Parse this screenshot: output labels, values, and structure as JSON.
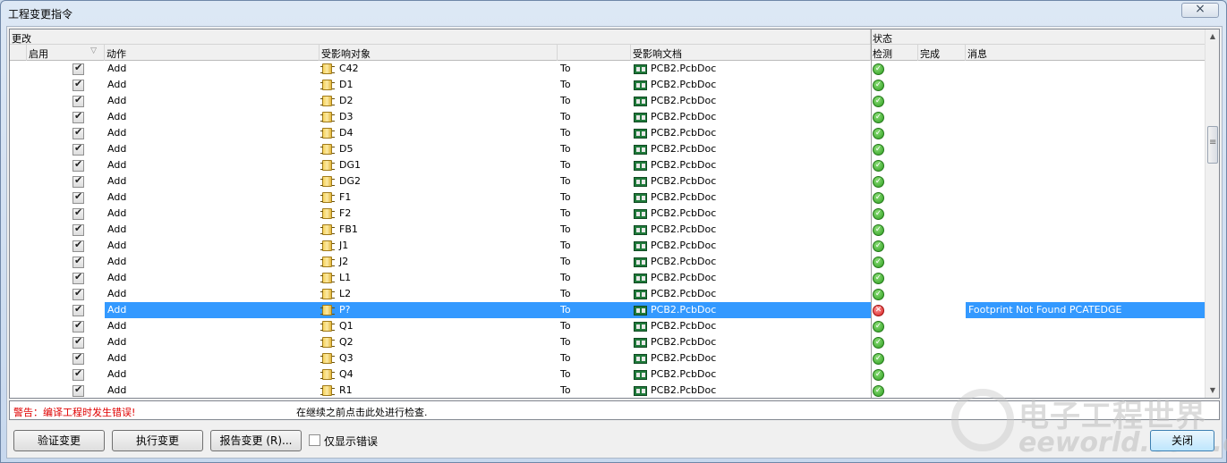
{
  "window": {
    "title": "工程变更指令",
    "close_glyph": "×"
  },
  "groups": {
    "changes": "更改",
    "status": "状态"
  },
  "columns": {
    "enable": "启用",
    "action": "动作",
    "affected_object": "受影响对象",
    "to": "",
    "affected_document": "受影响文档",
    "check": "检测",
    "done": "完成",
    "message": "消息"
  },
  "rows": [
    {
      "action": "Add",
      "object": "C42",
      "to": "To",
      "document": "PCB2.PcbDoc",
      "check": "ok",
      "message": ""
    },
    {
      "action": "Add",
      "object": "D1",
      "to": "To",
      "document": "PCB2.PcbDoc",
      "check": "ok",
      "message": ""
    },
    {
      "action": "Add",
      "object": "D2",
      "to": "To",
      "document": "PCB2.PcbDoc",
      "check": "ok",
      "message": ""
    },
    {
      "action": "Add",
      "object": "D3",
      "to": "To",
      "document": "PCB2.PcbDoc",
      "check": "ok",
      "message": ""
    },
    {
      "action": "Add",
      "object": "D4",
      "to": "To",
      "document": "PCB2.PcbDoc",
      "check": "ok",
      "message": ""
    },
    {
      "action": "Add",
      "object": "D5",
      "to": "To",
      "document": "PCB2.PcbDoc",
      "check": "ok",
      "message": ""
    },
    {
      "action": "Add",
      "object": "DG1",
      "to": "To",
      "document": "PCB2.PcbDoc",
      "check": "ok",
      "message": ""
    },
    {
      "action": "Add",
      "object": "DG2",
      "to": "To",
      "document": "PCB2.PcbDoc",
      "check": "ok",
      "message": ""
    },
    {
      "action": "Add",
      "object": "F1",
      "to": "To",
      "document": "PCB2.PcbDoc",
      "check": "ok",
      "message": ""
    },
    {
      "action": "Add",
      "object": "F2",
      "to": "To",
      "document": "PCB2.PcbDoc",
      "check": "ok",
      "message": ""
    },
    {
      "action": "Add",
      "object": "FB1",
      "to": "To",
      "document": "PCB2.PcbDoc",
      "check": "ok",
      "message": ""
    },
    {
      "action": "Add",
      "object": "J1",
      "to": "To",
      "document": "PCB2.PcbDoc",
      "check": "ok",
      "message": ""
    },
    {
      "action": "Add",
      "object": "J2",
      "to": "To",
      "document": "PCB2.PcbDoc",
      "check": "ok",
      "message": ""
    },
    {
      "action": "Add",
      "object": "L1",
      "to": "To",
      "document": "PCB2.PcbDoc",
      "check": "ok",
      "message": ""
    },
    {
      "action": "Add",
      "object": "L2",
      "to": "To",
      "document": "PCB2.PcbDoc",
      "check": "ok",
      "message": ""
    },
    {
      "action": "Add",
      "object": "P?",
      "to": "To",
      "document": "PCB2.PcbDoc",
      "check": "error",
      "message": "Footprint Not Found PCATEDGE",
      "selected": true
    },
    {
      "action": "Add",
      "object": "Q1",
      "to": "To",
      "document": "PCB2.PcbDoc",
      "check": "ok",
      "message": ""
    },
    {
      "action": "Add",
      "object": "Q2",
      "to": "To",
      "document": "PCB2.PcbDoc",
      "check": "ok",
      "message": ""
    },
    {
      "action": "Add",
      "object": "Q3",
      "to": "To",
      "document": "PCB2.PcbDoc",
      "check": "ok",
      "message": ""
    },
    {
      "action": "Add",
      "object": "Q4",
      "to": "To",
      "document": "PCB2.PcbDoc",
      "check": "ok",
      "message": ""
    },
    {
      "action": "Add",
      "object": "R1",
      "to": "To",
      "document": "PCB2.PcbDoc",
      "check": "ok",
      "message": ""
    }
  ],
  "status": {
    "warning": "警告：编译工程时发生错误!",
    "hint": "在继续之前点击此处进行检查."
  },
  "buttons": {
    "validate": "验证变更",
    "execute": "执行变更",
    "report": "报告变更 (R)...",
    "only_errors": "仅显示错误",
    "close": "关闭"
  },
  "watermark": {
    "line1": "电子工程世界",
    "line2": "eeworld.com.cn"
  },
  "colors": {
    "selection": "#3399ff",
    "warning_text": "#e00000",
    "ok": "#2c9d1e",
    "error": "#d61a1a"
  }
}
